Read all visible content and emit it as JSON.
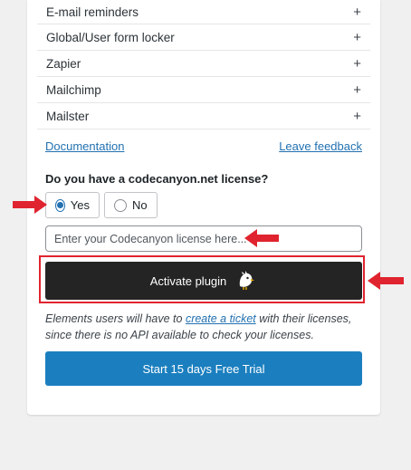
{
  "features": [
    {
      "label": "E-mail reminders",
      "expand": "+"
    },
    {
      "label": "Global/User form locker",
      "expand": "+"
    },
    {
      "label": "Zapier",
      "expand": "+"
    },
    {
      "label": "Mailchimp",
      "expand": "+"
    },
    {
      "label": "Mailster",
      "expand": "+"
    }
  ],
  "links": {
    "documentation": "Documentation",
    "feedback": "Leave feedback"
  },
  "license": {
    "question": "Do you have a codecanyon.net license?",
    "yes_label": "Yes",
    "no_label": "No",
    "selected": "Yes",
    "placeholder": "Enter your Codecanyon license here...",
    "value": ""
  },
  "activate": {
    "label": "Activate plugin"
  },
  "note": {
    "before": "Elements users will have to ",
    "link": "create a ticket",
    "after": " with their licenses, since there is no API available to check your licenses."
  },
  "trial": {
    "label": "Start 15 days Free Trial"
  },
  "colors": {
    "accent": "#2271b1",
    "trial_button": "#1b7fbf",
    "activate_button": "#242424",
    "annotation_red": "#e0242f"
  },
  "icons": {
    "annotation_arrow": "red-arrow-icon",
    "mascot": "bird-mascot-icon"
  }
}
